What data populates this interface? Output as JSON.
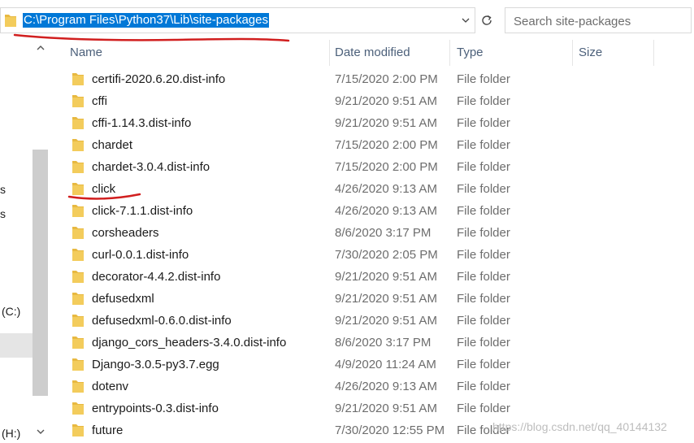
{
  "address_bar": {
    "path": "C:\\Program Files\\Python37\\Lib\\site-packages"
  },
  "search": {
    "placeholder": "Search site-packages"
  },
  "nav_pane": {
    "fragment_1": "s",
    "fragment_2": "s",
    "drive_c": "(C:)",
    "drive_h": "(H:)"
  },
  "columns": {
    "name": "Name",
    "date_modified": "Date modified",
    "type": "Type",
    "size": "Size"
  },
  "files": [
    {
      "name": "certifi-2020.6.20.dist-info",
      "date": "7/15/2020 2:00 PM",
      "type": "File folder"
    },
    {
      "name": "cffi",
      "date": "9/21/2020 9:51 AM",
      "type": "File folder"
    },
    {
      "name": "cffi-1.14.3.dist-info",
      "date": "9/21/2020 9:51 AM",
      "type": "File folder"
    },
    {
      "name": "chardet",
      "date": "7/15/2020 2:00 PM",
      "type": "File folder"
    },
    {
      "name": "chardet-3.0.4.dist-info",
      "date": "7/15/2020 2:00 PM",
      "type": "File folder"
    },
    {
      "name": "click",
      "date": "4/26/2020 9:13 AM",
      "type": "File folder"
    },
    {
      "name": "click-7.1.1.dist-info",
      "date": "4/26/2020 9:13 AM",
      "type": "File folder"
    },
    {
      "name": "corsheaders",
      "date": "8/6/2020 3:17 PM",
      "type": "File folder"
    },
    {
      "name": "curl-0.0.1.dist-info",
      "date": "7/30/2020 2:05 PM",
      "type": "File folder"
    },
    {
      "name": "decorator-4.4.2.dist-info",
      "date": "9/21/2020 9:51 AM",
      "type": "File folder"
    },
    {
      "name": "defusedxml",
      "date": "9/21/2020 9:51 AM",
      "type": "File folder"
    },
    {
      "name": "defusedxml-0.6.0.dist-info",
      "date": "9/21/2020 9:51 AM",
      "type": "File folder"
    },
    {
      "name": "django_cors_headers-3.4.0.dist-info",
      "date": "8/6/2020 3:17 PM",
      "type": "File folder"
    },
    {
      "name": "Django-3.0.5-py3.7.egg",
      "date": "4/9/2020 11:24 AM",
      "type": "File folder"
    },
    {
      "name": "dotenv",
      "date": "4/26/2020 9:13 AM",
      "type": "File folder"
    },
    {
      "name": "entrypoints-0.3.dist-info",
      "date": "9/21/2020 9:51 AM",
      "type": "File folder"
    },
    {
      "name": "future",
      "date": "7/30/2020 12:55 PM",
      "type": "File folder"
    }
  ],
  "watermark": "https://blog.csdn.net/qq_40144132",
  "colors": {
    "selection": "#0078d7",
    "folder": "#e8b941",
    "annotation": "#d11f1f"
  }
}
